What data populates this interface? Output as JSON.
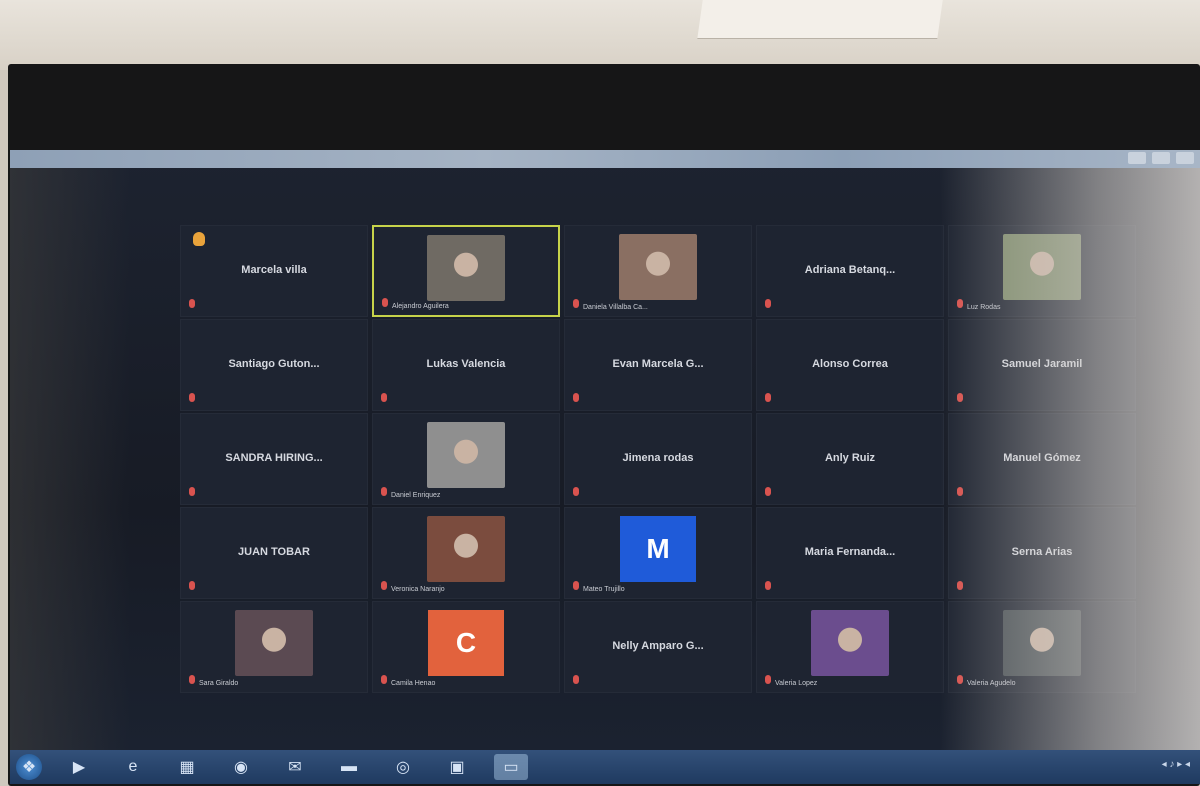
{
  "taskbar": {
    "items": [
      {
        "icon": "start-orb-icon",
        "glyph": "❖"
      },
      {
        "icon": "media-player-icon",
        "glyph": "▶"
      },
      {
        "icon": "internet-explorer-icon",
        "glyph": "e"
      },
      {
        "icon": "calculator-icon",
        "glyph": "▦"
      },
      {
        "icon": "chrome-icon",
        "glyph": "◉"
      },
      {
        "icon": "mail-icon",
        "glyph": "✉"
      },
      {
        "icon": "folder-icon",
        "glyph": "▬"
      },
      {
        "icon": "browser-icon",
        "glyph": "◎"
      },
      {
        "icon": "app-icon",
        "glyph": "▣"
      },
      {
        "icon": "zoom-icon",
        "glyph": "▭"
      }
    ],
    "tray_text": "◂ ♪ ▸ ◂"
  },
  "participants": [
    {
      "name": "Marcela villa",
      "caption": "",
      "type": "name",
      "hand": true
    },
    {
      "name": "",
      "caption": "Alejandro Aguilera",
      "type": "video",
      "active": true,
      "color": "#6f6a63"
    },
    {
      "name": "",
      "caption": "Daniela Villalba Ca...",
      "type": "video",
      "color": "#8a6f62"
    },
    {
      "name": "Adriana Betanq...",
      "caption": "",
      "type": "name"
    },
    {
      "name": "",
      "caption": "Luz Rodas",
      "type": "video",
      "color": "#7c8a6a"
    },
    {
      "name": "Santiago Guton...",
      "caption": "",
      "type": "name"
    },
    {
      "name": "Lukas Valencia",
      "caption": "",
      "type": "name"
    },
    {
      "name": "Evan Marcela G...",
      "caption": "",
      "type": "name"
    },
    {
      "name": "Alonso Correa",
      "caption": "",
      "type": "name"
    },
    {
      "name": "Samuel Jaramil",
      "caption": "",
      "type": "name"
    },
    {
      "name": "SANDRA HIRING...",
      "caption": "",
      "type": "name"
    },
    {
      "name": "",
      "caption": "Daniel Enriquez",
      "type": "video",
      "color": "#8f8f8f"
    },
    {
      "name": "Jimena rodas",
      "caption": "",
      "type": "name"
    },
    {
      "name": "Anly Ruiz",
      "caption": "",
      "type": "name"
    },
    {
      "name": "Manuel Gómez",
      "caption": "",
      "type": "name"
    },
    {
      "name": "JUAN TOBAR",
      "caption": "",
      "type": "name"
    },
    {
      "name": "",
      "caption": "Veronica Naranjo",
      "type": "video",
      "color": "#7b4c3e"
    },
    {
      "name": "",
      "caption": "Mateo Trujillo",
      "type": "avatar",
      "letter": "M",
      "color": "#1f5bd9"
    },
    {
      "name": "Maria Fernanda...",
      "caption": "",
      "type": "name"
    },
    {
      "name": "Serna Arias",
      "caption": "",
      "type": "name"
    },
    {
      "name": "",
      "caption": "Sara Giraldo",
      "type": "video",
      "color": "#5b4a52"
    },
    {
      "name": "",
      "caption": "Camila Henao",
      "type": "avatar",
      "letter": "C",
      "color": "#e2623d"
    },
    {
      "name": "Nelly Amparo G...",
      "caption": "",
      "type": "name"
    },
    {
      "name": "",
      "caption": "Valeria Lopez",
      "type": "video",
      "color": "#6b4d8e"
    },
    {
      "name": "",
      "caption": "Valeria Agudelo",
      "type": "video",
      "color": "#474f54"
    }
  ]
}
